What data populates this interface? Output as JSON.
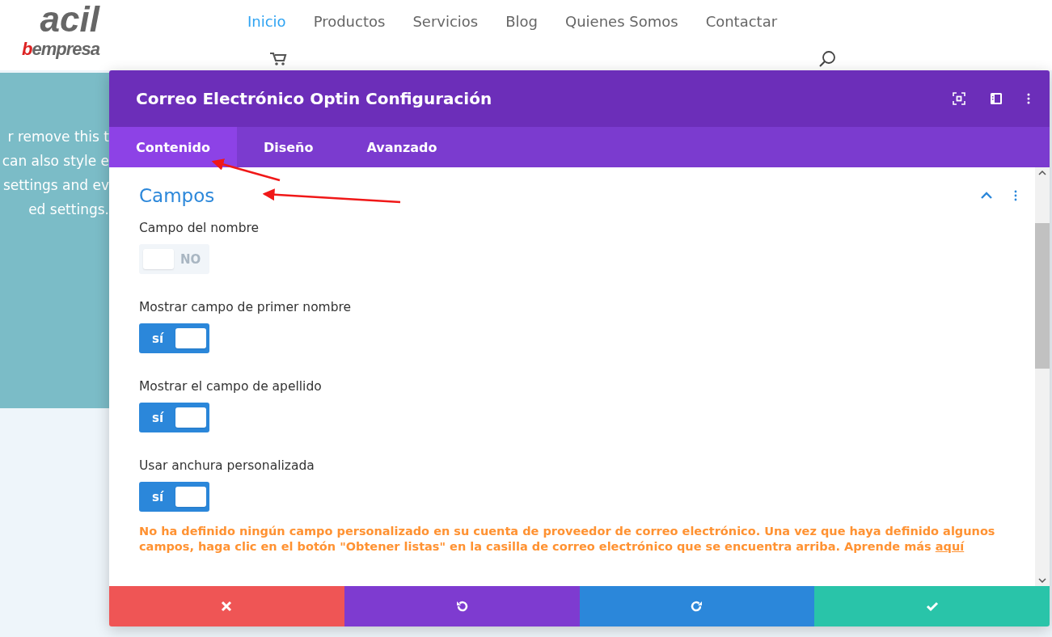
{
  "site": {
    "logo_top": "acil",
    "logo_accent": "b",
    "logo_rest": "empresa"
  },
  "nav": [
    {
      "label": "Inicio",
      "selected": true
    },
    {
      "label": "Productos",
      "selected": false
    },
    {
      "label": "Servicios",
      "selected": false
    },
    {
      "label": "Blog",
      "selected": false
    },
    {
      "label": "Quienes Somos",
      "selected": false
    },
    {
      "label": "Contactar",
      "selected": false
    }
  ],
  "background_text": [
    "r remove this t",
    "can also style e",
    "settings and ev",
    "ed settings."
  ],
  "modal": {
    "title": "Correo Electrónico Optin Configuración",
    "tabs": [
      {
        "label": "Contenido",
        "selected": true
      },
      {
        "label": "Diseño",
        "selected": false
      },
      {
        "label": "Avanzado",
        "selected": false
      }
    ],
    "section": {
      "title": "Campos",
      "expanded": true,
      "toggles": [
        {
          "label": "Campo del nombre",
          "on": false,
          "value_text": "NO"
        },
        {
          "label": "Mostrar campo de primer nombre",
          "on": true,
          "value_text": "sí"
        },
        {
          "label": "Mostrar el campo de apellido",
          "on": true,
          "value_text": "sí"
        },
        {
          "label": "Usar anchura personalizada",
          "on": true,
          "value_text": "sí"
        }
      ],
      "notice": "No ha definido ningún campo personalizado en su cuenta de proveedor de correo electrónico. Una vez que haya definido algunos campos, haga clic en el botón \"Obtener listas\" en la casilla de correo electrónico que se encuentra arriba. Aprende más",
      "notice_link": "aquí"
    },
    "footer": [
      {
        "kind": "cancel"
      },
      {
        "kind": "undo"
      },
      {
        "kind": "redo"
      },
      {
        "kind": "save"
      }
    ]
  }
}
